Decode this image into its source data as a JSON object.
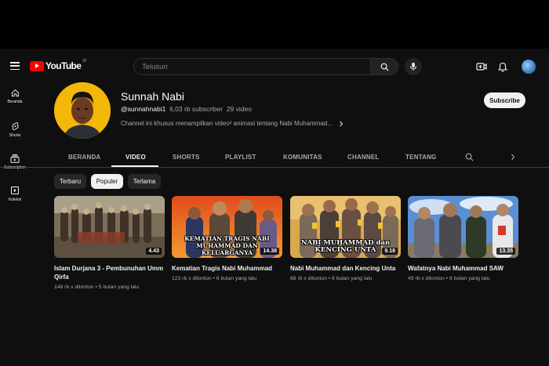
{
  "header": {
    "logo_text": "YouTube",
    "logo_country": "ID",
    "search_placeholder": "Telusuri"
  },
  "sidebar": {
    "items": [
      {
        "label": "Beranda",
        "icon": "home-icon"
      },
      {
        "label": "Shorts",
        "icon": "shorts-icon"
      },
      {
        "label": "Subscription",
        "icon": "subscriptions-icon"
      },
      {
        "label": "Koleksi",
        "icon": "library-icon"
      }
    ]
  },
  "channel": {
    "name": "Sunnah Nabi",
    "handle": "@sunnahnabi1",
    "subscribers": "6,03 rb subscriber",
    "videos": "29 video",
    "description": "Channel ini khusus menampilkan video² animasi tentang Nabi Muhammad...",
    "subscribe_label": "Subscribe"
  },
  "tabs": [
    "BERANDA",
    "VIDEO",
    "SHORTS",
    "PLAYLIST",
    "KOMUNITAS",
    "CHANNEL",
    "TENTANG"
  ],
  "active_tab": "VIDEO",
  "filters": [
    {
      "label": "Terbaru",
      "active": false
    },
    {
      "label": "Populer",
      "active": true
    },
    {
      "label": "Terlama",
      "active": false
    }
  ],
  "videos": [
    {
      "title": "Islam Durjana 3 - Pembunuhan Umm Qirfa",
      "views": "148 rb x ditonton",
      "age": "5 bulan yang lalu",
      "duration": "4.43",
      "caption": ""
    },
    {
      "title": "Kematian Tragis Nabi Muhammad",
      "views": "123 rb x ditonton",
      "age": "6 bulan yang lalu",
      "duration": "14.38",
      "caption": "KEMATIAN TRAGIS NABI MUHAMMAD DAN KELUARGANYA"
    },
    {
      "title": "Nabi Muhammad dan Kencing Unta",
      "views": "68 rb x ditonton",
      "age": "6 bulan yang lalu",
      "duration": "9.18",
      "caption": "NABI MUHAMMAD dan KENCING UNTA"
    },
    {
      "title": "Wafatnya Nabi Muhammad SAW",
      "views": "49 rb x ditonton",
      "age": "8 bulan yang lalu",
      "duration": "13.35",
      "caption": ""
    }
  ],
  "colors": {
    "accent": "#ff0000",
    "background": "#0f0f0f",
    "avatar_bg": "#f2b707"
  }
}
